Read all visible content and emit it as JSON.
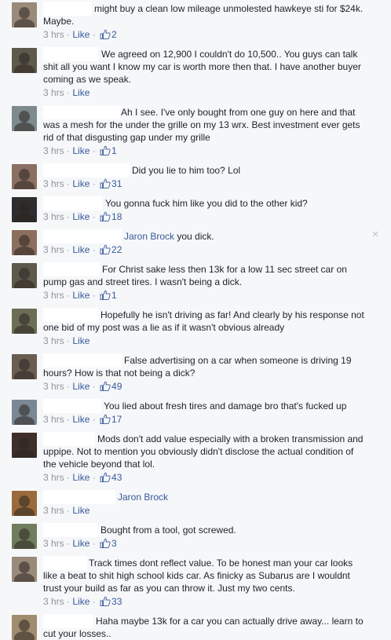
{
  "comments": [
    {
      "line1": "might buy a clean low mileage unmolested hawkeye sti for $24k.",
      "rest": "Maybe.",
      "time": "3 hrs",
      "like_label": "Like",
      "likes": "2",
      "avatar_color": "#9a8a7a"
    },
    {
      "line1": "We agreed on 12,900 I couldn't do 10,500.. You guys can talk",
      "rest": "shit all you want I know my car is worth more then that. I have another buyer\ncoming as we speak.",
      "time": "3 hrs",
      "like_label": "Like",
      "likes": "",
      "avatar_color": "#5d5a4c"
    },
    {
      "line1": "Ah I see. I've only bought from one guy on here and that",
      "rest": "was a mesh for the under the grille on my 13 wrx. Best investment ever gets\nrid of that disgusting gap under my grille",
      "time": "3 hrs",
      "like_label": "Like",
      "likes": "1",
      "avatar_color": "#7d8a8e"
    },
    {
      "line1": "Did you lie to him too? Lol",
      "rest": "",
      "time": "3 hrs",
      "like_label": "Like",
      "likes": "31",
      "avatar_color": "#8a6f62"
    },
    {
      "line1": "You gonna fuck him like you did to the other kid?",
      "rest": "",
      "time": "3 hrs",
      "like_label": "Like",
      "likes": "18",
      "avatar_color": "#2e2e2e"
    },
    {
      "mention": "Jaron Brock",
      "line1": " you dick.",
      "rest": "",
      "time": "3 hrs",
      "like_label": "Like",
      "likes": "22",
      "avatar_color": "#8c6e5e",
      "close": "×"
    },
    {
      "line1": "For Christ sake less then 13k for a low 11 sec street car on",
      "rest": "pump gas and street tires. I wasn't being a dick.",
      "time": "3 hrs",
      "like_label": "Like",
      "likes": "1",
      "avatar_color": "#5d5a4c"
    },
    {
      "line1": "Hopefully he isn't driving as far! And clearly by his response not",
      "rest": "one bid of my post was a lie as if it wasn't obvious already",
      "time": "3 hrs",
      "like_label": "Like",
      "likes": "",
      "avatar_color": "#6b6e55"
    },
    {
      "line1": "False advertising on a car when someone is driving 19",
      "rest": "hours? How is that not being a dick?",
      "time": "3 hrs",
      "like_label": "Like",
      "likes": "49",
      "avatar_color": "#6a5d52"
    },
    {
      "line1": "You lied about fresh tires and damage bro that's fucked up",
      "rest": "",
      "time": "3 hrs",
      "like_label": "Like",
      "likes": "17",
      "avatar_color": "#7a8794"
    },
    {
      "line1": "Mods don't add value especially with a broken transmission and",
      "rest": "uppipe. Not to mention you obviously didn't disclose the actual condition of\nthe vehicle beyond that lol.",
      "time": "3 hrs",
      "like_label": "Like",
      "likes": "43",
      "avatar_color": "#3e2f2a"
    },
    {
      "mention": "Jaron Brock",
      "line1": "",
      "rest": "",
      "time": "3 hrs",
      "like_label": "Like",
      "likes": "",
      "avatar_color": "#9a6a3c"
    },
    {
      "line1": "Bought from a tool, got screwed.",
      "rest": "",
      "time": "3 hrs",
      "like_label": "Like",
      "likes": "3",
      "avatar_color": "#6f7d5e"
    },
    {
      "line1": "Track times dont reflect value. To be honest man your car looks",
      "rest": "like a beat to shit high school kids car. As finicky as Subarus are I wouldnt\ntrust your build as far as you can throw it. Just my two cents.",
      "time": "3 hrs",
      "like_label": "Like",
      "likes": "33",
      "avatar_color": "#9a8a7a"
    },
    {
      "line1": "Haha maybe 13k for a car you can actually drive away... learn to",
      "rest": "cut your losses..",
      "time": "",
      "like_label": "",
      "likes": "",
      "avatar_color": "#a08c6e"
    }
  ]
}
